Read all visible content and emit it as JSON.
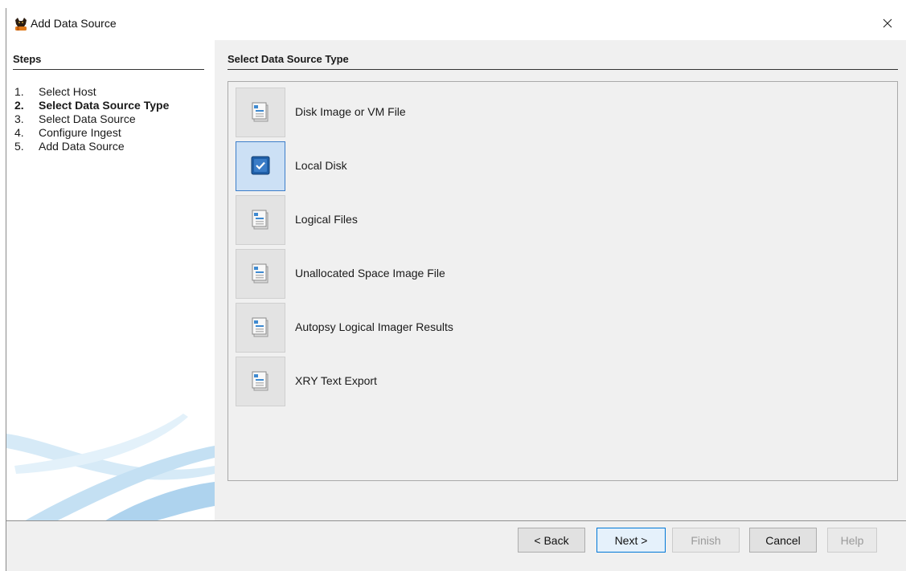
{
  "window": {
    "title": "Add Data Source",
    "close_glyph": "✕"
  },
  "steps": {
    "header": "Steps",
    "items": [
      {
        "num": "1.",
        "label": "Select Host",
        "active": false
      },
      {
        "num": "2.",
        "label": "Select Data Source Type",
        "active": true
      },
      {
        "num": "3.",
        "label": "Select Data Source",
        "active": false
      },
      {
        "num": "4.",
        "label": "Configure Ingest",
        "active": false
      },
      {
        "num": "5.",
        "label": "Add Data Source",
        "active": false
      }
    ]
  },
  "main": {
    "section_title": "Select Data Source Type",
    "types": [
      {
        "label": "Disk Image or VM File",
        "icon": "document-icon",
        "selected": false
      },
      {
        "label": "Local Disk",
        "icon": "checkbox-checked-icon",
        "selected": true
      },
      {
        "label": "Logical Files",
        "icon": "document-icon",
        "selected": false
      },
      {
        "label": "Unallocated Space Image File",
        "icon": "document-icon",
        "selected": false
      },
      {
        "label": "Autopsy Logical Imager Results",
        "icon": "document-icon",
        "selected": false
      },
      {
        "label": "XRY Text Export",
        "icon": "document-icon",
        "selected": false
      }
    ]
  },
  "footer": {
    "back_label": "< Back",
    "next_label": "Next >",
    "finish_label": "Finish",
    "cancel_label": "Cancel",
    "help_label": "Help"
  },
  "colors": {
    "selected_bg": "#cce0f5",
    "selected_border": "#3d7ec9",
    "default_button_border": "#0078d7"
  }
}
